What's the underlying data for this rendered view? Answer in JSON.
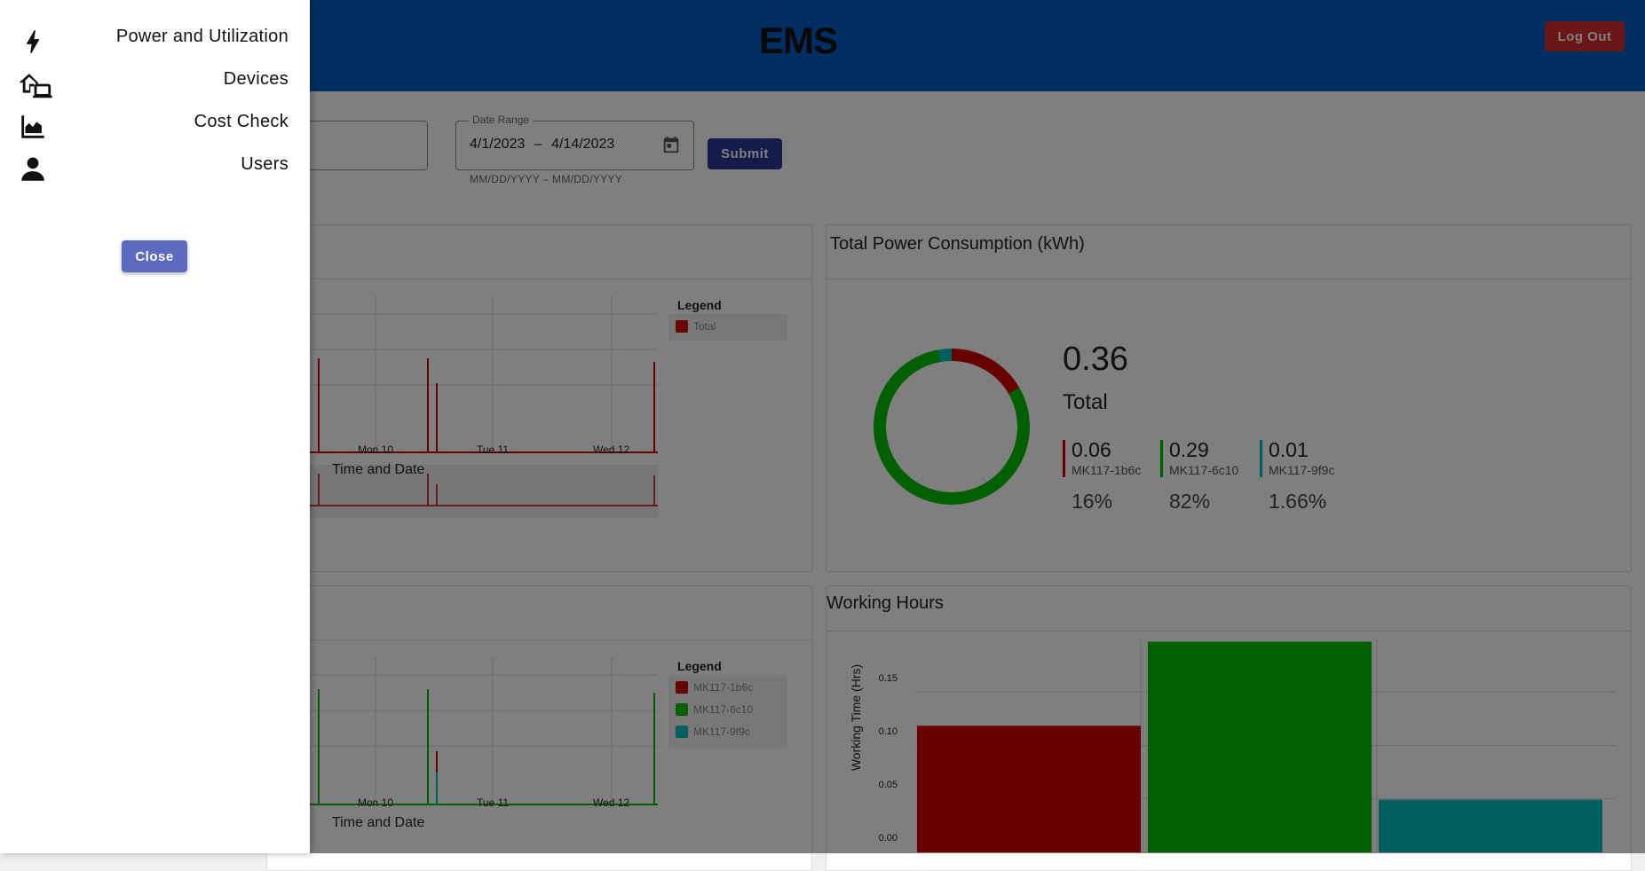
{
  "header": {
    "title": "EMS",
    "logout_label": "Log Out"
  },
  "filters": {
    "date_range_label": "Date Range",
    "date_start": "4/1/2023",
    "date_separator": "–",
    "date_end": "4/14/2023",
    "date_helper": "MM/DD/YYYY – MM/DD/YYYY",
    "submit_label": "Submit"
  },
  "power_chart": {
    "legend_title": "Legend",
    "legend": [
      {
        "name": "Total",
        "color": "#d00000"
      }
    ],
    "x_ticks": [
      "Mon 10",
      "Tue 11",
      "Wed 12"
    ],
    "x_title": "Time and Date"
  },
  "device_chart": {
    "legend_title": "Legend",
    "legend": [
      {
        "name": "MK117-1b6c",
        "color": "#d00000"
      },
      {
        "name": "MK117-6c10",
        "color": "#00c000"
      },
      {
        "name": "MK117-9f9c",
        "color": "#00c0c0"
      }
    ],
    "x_ticks": [
      "Mon 10",
      "Tue 11",
      "Wed 12"
    ],
    "x_title": "Time and Date"
  },
  "consumption": {
    "title": "Total Power Consumption (kWh)",
    "total_value": "0.36",
    "total_label": "Total",
    "devices": [
      {
        "value": "0.06",
        "name": "MK117-1b6c",
        "pct": "16%",
        "color": "#d00000"
      },
      {
        "value": "0.29",
        "name": "MK117-6c10",
        "pct": "82%",
        "color": "#00c000"
      },
      {
        "value": "0.01",
        "name": "MK117-9f9c",
        "pct": "1.66%",
        "color": "#00c0c0"
      }
    ]
  },
  "working_hours": {
    "title": "Working Hours",
    "y_title": "Working Time (Hrs)",
    "y_ticks": [
      "0.15",
      "0.10",
      "0.05",
      "0.00"
    ]
  },
  "chart_data": [
    {
      "type": "pie",
      "title": "Total Power Consumption (kWh)",
      "categories": [
        "MK117-1b6c",
        "MK117-6c10",
        "MK117-9f9c"
      ],
      "values": [
        0.06,
        0.29,
        0.01
      ],
      "colors": [
        "#d00000",
        "#00c000",
        "#00c0c0"
      ]
    },
    {
      "type": "bar",
      "title": "Working Hours",
      "ylabel": "Working Time (Hrs)",
      "categories": [
        "MK117-1b6c",
        "MK117-6c10",
        "MK117-9f9c"
      ],
      "values": [
        0.113,
        0.188,
        0.047
      ],
      "colors": [
        "#d00000",
        "#00c000",
        "#00c0c0"
      ],
      "ylim": [
        0,
        0.19
      ]
    }
  ],
  "drawer": {
    "items": [
      {
        "label": "Power and Utilization",
        "icon": "lightning-icon"
      },
      {
        "label": "Devices",
        "icon": "home-devices-icon"
      },
      {
        "label": "Cost Check",
        "icon": "area-chart-icon"
      },
      {
        "label": "Users",
        "icon": "person-icon"
      }
    ],
    "close_label": "Close"
  }
}
